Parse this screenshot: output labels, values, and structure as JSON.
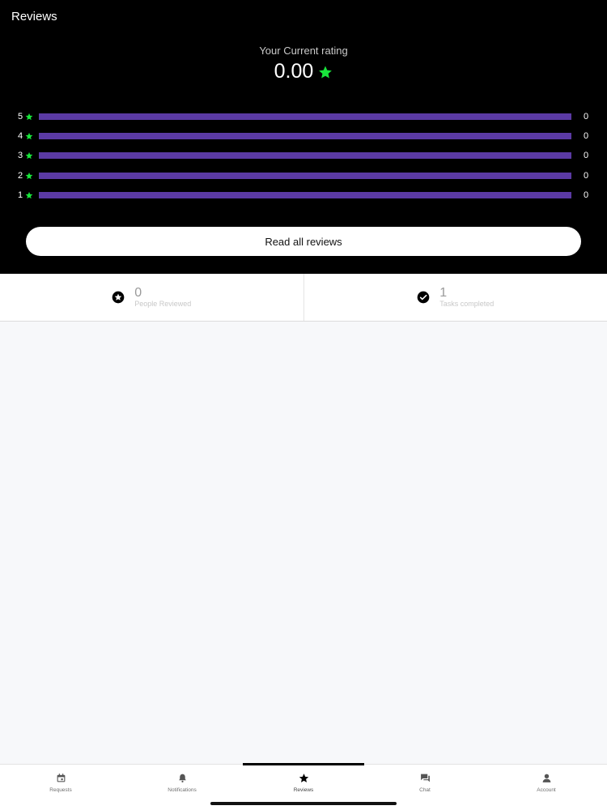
{
  "header": {
    "title": "Reviews",
    "rating_label": "Your Current rating",
    "rating_value": "0.00",
    "star_color": "#19e63c",
    "bar_color": "#5b3aa4"
  },
  "distribution": [
    {
      "stars": "5",
      "count": "0",
      "fill": 1.0
    },
    {
      "stars": "4",
      "count": "0",
      "fill": 1.0
    },
    {
      "stars": "3",
      "count": "0",
      "fill": 1.0
    },
    {
      "stars": "2",
      "count": "0",
      "fill": 1.0
    },
    {
      "stars": "1",
      "count": "0",
      "fill": 1.0
    }
  ],
  "read_all_label": "Read all reviews",
  "stats": {
    "reviewed": {
      "value": "0",
      "label": "People Reviewed",
      "icon": "star-circle-icon"
    },
    "tasks": {
      "value": "1",
      "label": "Tasks completed",
      "icon": "check-circle-icon"
    }
  },
  "tabs": [
    {
      "label": "Requests",
      "icon": "calendar-icon"
    },
    {
      "label": "Notifications",
      "icon": "bell-icon"
    },
    {
      "label": "Reviews",
      "icon": "star-icon",
      "active": true
    },
    {
      "label": "Chat",
      "icon": "chat-icon"
    },
    {
      "label": "Account",
      "icon": "person-icon"
    }
  ]
}
